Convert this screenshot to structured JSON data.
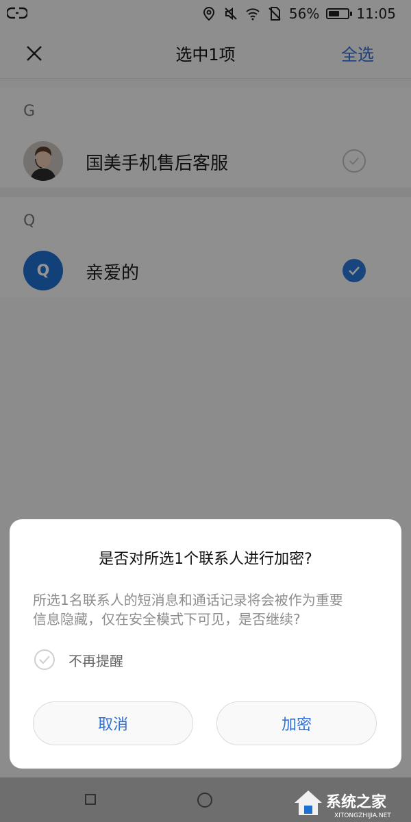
{
  "status_bar": {
    "battery_percent": "56%",
    "battery_level": 0.56,
    "time": "11:05",
    "icons": [
      "link-icon",
      "location-icon",
      "mute-icon",
      "wifi-icon",
      "no-sim-icon",
      "battery-icon"
    ]
  },
  "header": {
    "title": "选中1项",
    "select_all": "全选",
    "close_icon": "close-icon"
  },
  "contacts": {
    "sections": [
      {
        "letter": "G",
        "items": [
          {
            "name": "国美手机售后客服",
            "avatar": "photo",
            "selected": false
          }
        ]
      },
      {
        "letter": "Q",
        "items": [
          {
            "name": "亲爱的",
            "avatar_letter": "Q",
            "selected": true
          }
        ]
      }
    ]
  },
  "dialog": {
    "title": "是否对所选1个联系人进行加密?",
    "message_line1": "所选1名联系人的短消息和通话记录将会被作为重要",
    "message_line2": "信息隐藏，仅在安全模式下可见，是否继续?",
    "remember_label": "不再提醒",
    "cancel_label": "取消",
    "confirm_label": "加密"
  },
  "watermark": {
    "brand": "系统之家",
    "url": "XITONGZHIJIA.NET"
  },
  "colors": {
    "accent": "#2f6fd8",
    "avatar_q": "#1f6fd0",
    "dialog_bg": "#ffffff"
  }
}
